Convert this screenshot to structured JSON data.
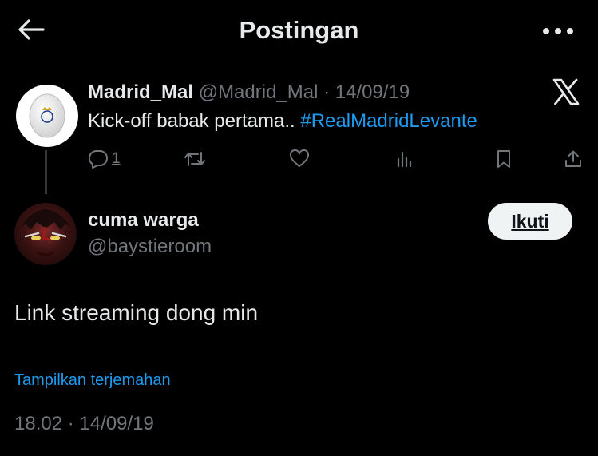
{
  "header": {
    "title": "Postingan",
    "back_icon": "arrow-left-icon",
    "more_icon": "more-horizontal-icon"
  },
  "quoted_post": {
    "author_name": "Madrid_Mal",
    "handle": "@Madrid_Mal",
    "separator": "·",
    "date": "14/09/19",
    "text": "Kick-off babak pertama.. ",
    "hashtag": "#RealMadridLevante",
    "avatar_icon": "egg-avatar-icon",
    "brand_icon": "x-logo-icon",
    "actions": {
      "reply_count": "1",
      "reply_icon": "reply-icon",
      "repost_icon": "repost-icon",
      "like_icon": "heart-icon",
      "views_icon": "views-icon",
      "bookmark_icon": "bookmark-icon",
      "share_icon": "share-icon"
    }
  },
  "reply_post": {
    "author_name": "cuma warga",
    "handle": "@baystieroom",
    "follow_label": "Ikuti",
    "text": "Link streaming dong min",
    "translate_label": "Tampilkan terjemahan",
    "timestamp": "18.02 · 14/09/19"
  },
  "colors": {
    "background": "#000000",
    "text_primary": "#e7e9ea",
    "text_secondary": "#71767b",
    "accent": "#1d9bf0",
    "button_bg": "#eff3f4"
  }
}
